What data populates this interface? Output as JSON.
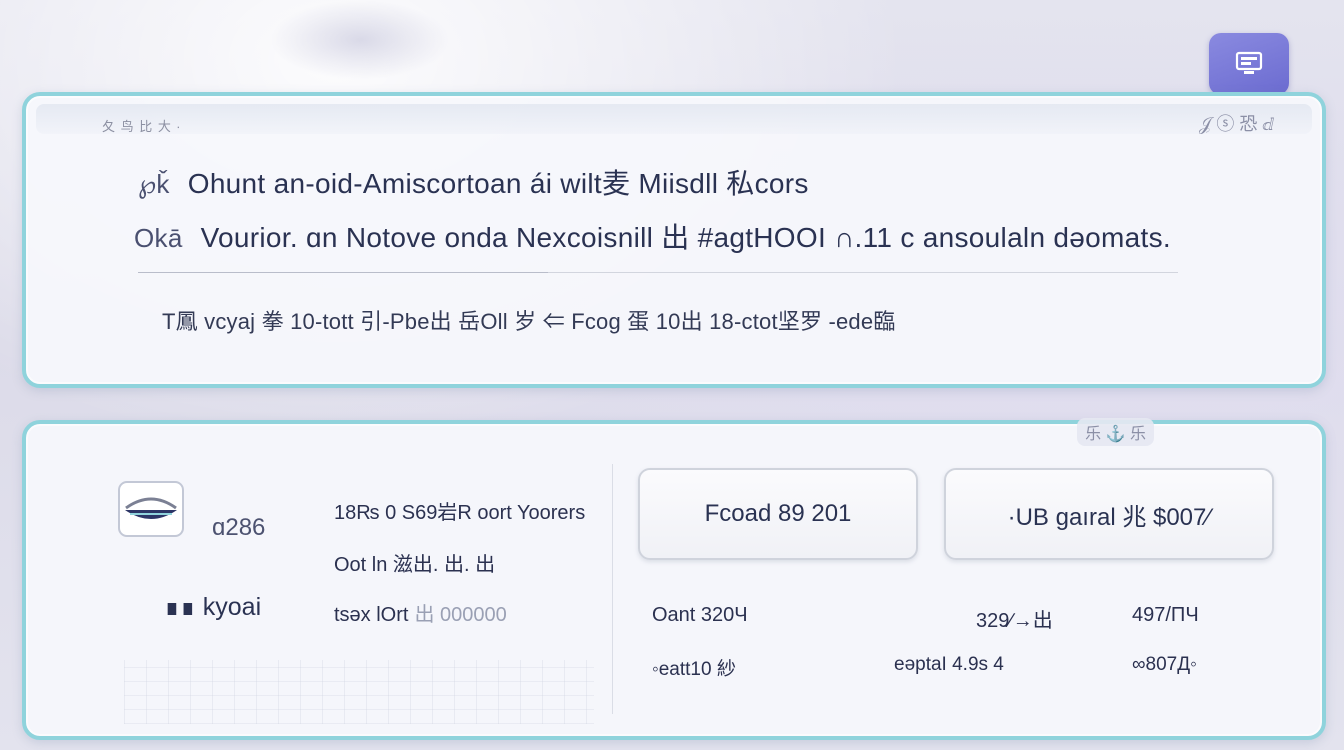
{
  "app_icon": {
    "name": "screen-icon"
  },
  "top_panel": {
    "strip_left": "夂 鸟 比 大 ∙",
    "strip_right": "𝒥 ⓢ 恐 ⅆ",
    "line1": {
      "tag": "℘ǩ",
      "text": "Ohunt an-oid-Amiscortoan ái wilt麦 Miisdll 私cors"
    },
    "line2": {
      "tag": "Okā",
      "text": "Vourior. ɑn Notove onda Nexcoisnill 出 #agtHOOI ∩.11 c ansoulaln dəomats."
    },
    "meta": "T鳳 vcyaj 拳 10-tott 引-Pbe出 岳Oll 岁   ⇐ Fcog 蛋    10出 18-ctot坚罗 ‐ede臨"
  },
  "bottom_panel": {
    "badge": "乐 ⚓ 乐",
    "pass_code": "ɑ286",
    "pass_name": "∎∎ kyoai",
    "detail_1": "18₨ 0 S69岩R oort   Yoorers",
    "detail_2": "Oot  ln 滋出. 出. 出",
    "detail_3_main": "tsǝx  lOrt",
    "detail_3_faded": "出 000000",
    "button_left": "Fcoad 89 201",
    "button_right": "·UB gaıral 兆 $007⁄",
    "fare_row_1": [
      "Oant 320Ч",
      "329∕→出",
      "497/ΠЧ"
    ],
    "fare_row_2": [
      "◦eatt10 紗",
      "eəptaI 4.9s 4",
      "∞807Д◦"
    ]
  }
}
